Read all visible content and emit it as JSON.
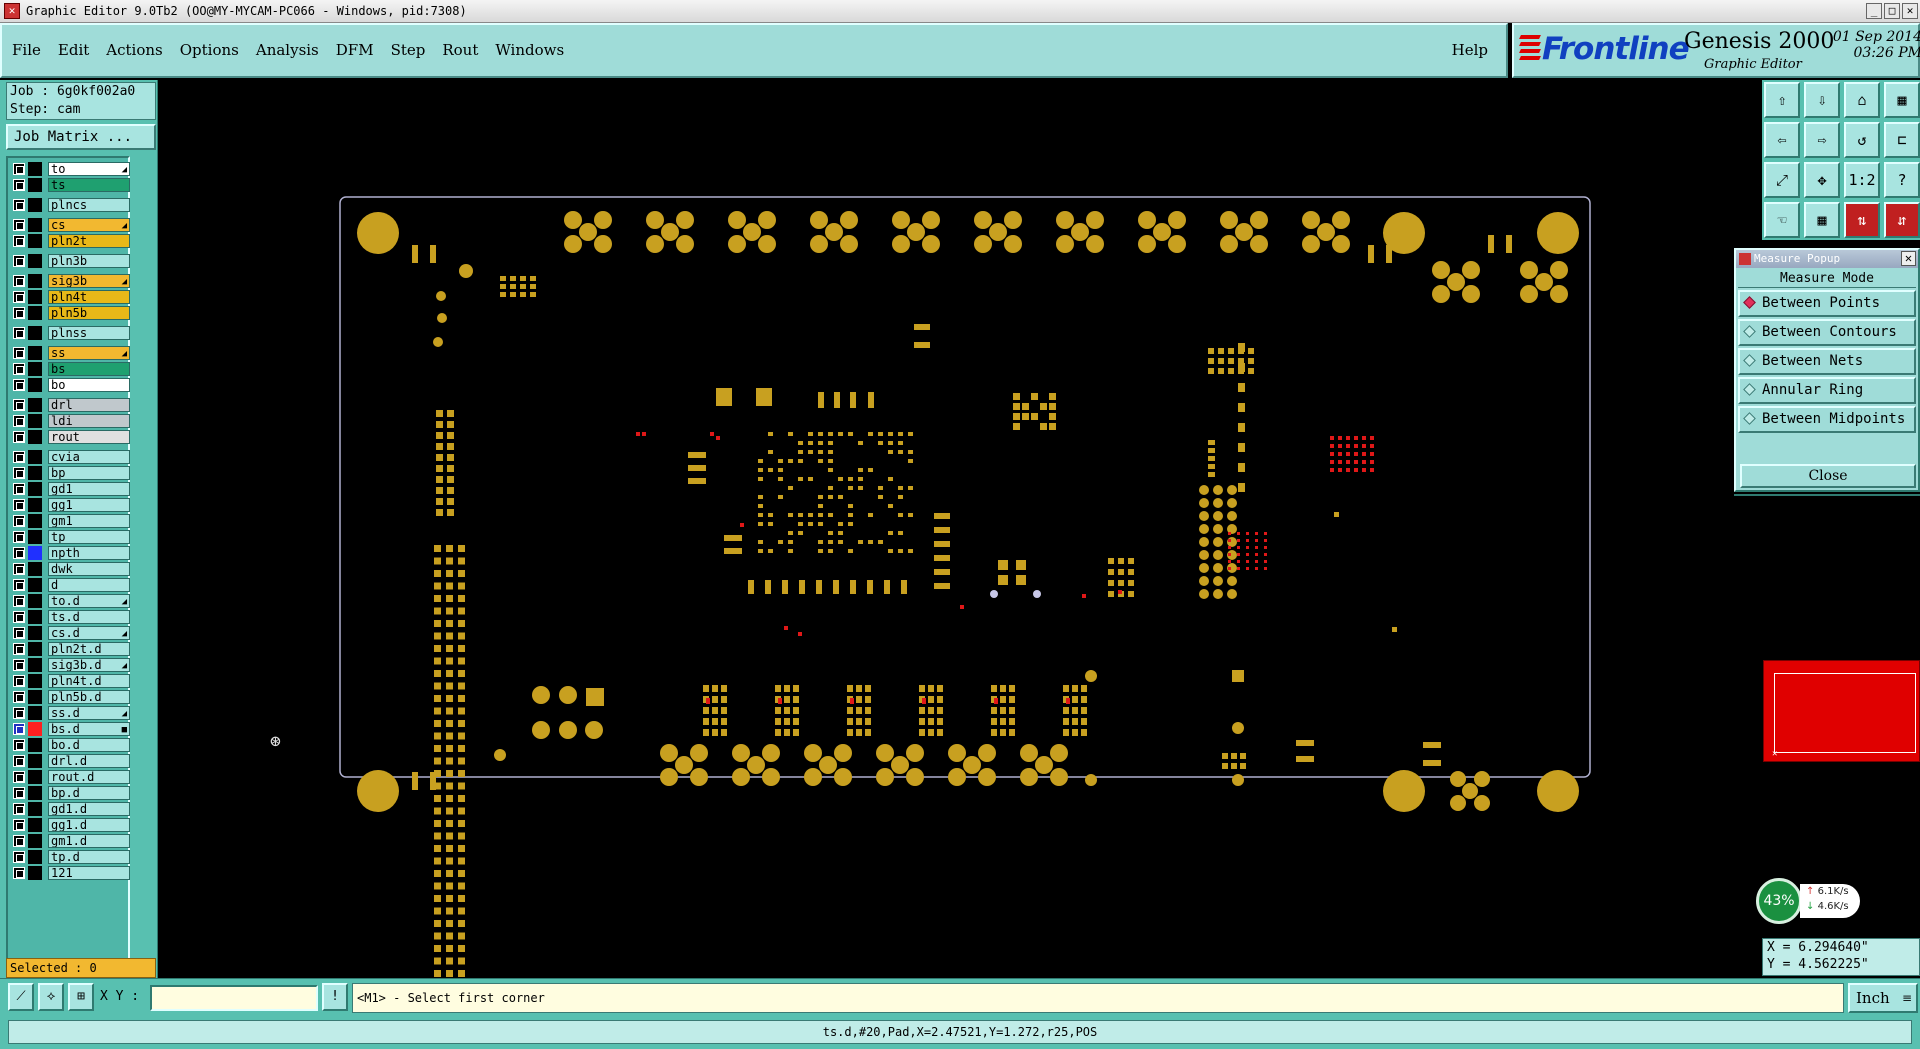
{
  "window": {
    "title": "Graphic Editor 9.0Tb2 (OO@MY-MYCAM-PC066 - Windows, pid:7308)",
    "controls": [
      "_",
      "□",
      "✕"
    ]
  },
  "menu": {
    "items": [
      "File",
      "Edit",
      "Actions",
      "Options",
      "Analysis",
      "DFM",
      "Step",
      "Rout",
      "Windows"
    ],
    "help": "Help"
  },
  "brand": {
    "logo": "Frontline",
    "product": "Genesis 2000",
    "subtitle": "Graphic Editor",
    "date": "01 Sep 2014",
    "time": "03:26 PM"
  },
  "job": {
    "job_line": "Job : 6g0kf002a0",
    "step_line": "Step: cam",
    "matrix_button": "Job Matrix ..."
  },
  "layers": [
    {
      "name": "to",
      "color": "#ffffff",
      "flag": "◢"
    },
    {
      "name": "ts",
      "color": "#1fa070",
      "flag": ""
    },
    {
      "name": "plncs",
      "color": "#a8e4e0",
      "flag": "",
      "gap": true
    },
    {
      "name": "cs",
      "color": "#f2b830",
      "flag": "◢",
      "gap": true
    },
    {
      "name": "pln2t",
      "color": "#e8b818",
      "flag": ""
    },
    {
      "name": "pln3b",
      "color": "#a8e4e0",
      "flag": "",
      "gap": true
    },
    {
      "name": "sig3b",
      "color": "#f2b830",
      "flag": "◢",
      "gap": true
    },
    {
      "name": "pln4t",
      "color": "#e8b818",
      "flag": ""
    },
    {
      "name": "pln5b",
      "color": "#e8b818",
      "flag": ""
    },
    {
      "name": "plnss",
      "color": "#a8e4e0",
      "flag": "",
      "gap": true
    },
    {
      "name": "ss",
      "color": "#f2b830",
      "flag": "◢",
      "gap": true
    },
    {
      "name": "bs",
      "color": "#1fa070",
      "flag": ""
    },
    {
      "name": "bo",
      "color": "#ffffff",
      "flag": ""
    },
    {
      "name": "drl",
      "color": "#c0c8cc",
      "flag": "",
      "gap": true
    },
    {
      "name": "ldi",
      "color": "#c0c8cc",
      "flag": ""
    },
    {
      "name": "rout",
      "color": "#e0e0e0",
      "flag": ""
    },
    {
      "name": "cvia",
      "color": "#a8e4e0",
      "flag": "",
      "gap": true
    },
    {
      "name": "bp",
      "color": "#a8e4e0",
      "flag": ""
    },
    {
      "name": "gd1",
      "color": "#a8e4e0",
      "flag": ""
    },
    {
      "name": "gg1",
      "color": "#a8e4e0",
      "flag": ""
    },
    {
      "name": "gm1",
      "color": "#a8e4e0",
      "flag": ""
    },
    {
      "name": "tp",
      "color": "#a8e4e0",
      "flag": ""
    },
    {
      "name": "npth",
      "color": "#a8e4e0",
      "flag": "",
      "swatch": "#2030ff"
    },
    {
      "name": "dwk",
      "color": "#a8e4e0",
      "flag": ""
    },
    {
      "name": "d",
      "color": "#a8e4e0",
      "flag": ""
    },
    {
      "name": "to.d",
      "color": "#a8e4e0",
      "flag": "◢"
    },
    {
      "name": "ts.d",
      "color": "#a8e4e0",
      "flag": ""
    },
    {
      "name": "cs.d",
      "color": "#a8e4e0",
      "flag": "◢"
    },
    {
      "name": "pln2t.d",
      "color": "#a8e4e0",
      "flag": ""
    },
    {
      "name": "sig3b.d",
      "color": "#a8e4e0",
      "flag": "◢"
    },
    {
      "name": "pln4t.d",
      "color": "#a8e4e0",
      "flag": ""
    },
    {
      "name": "pln5b.d",
      "color": "#a8e4e0",
      "flag": ""
    },
    {
      "name": "ss.d",
      "color": "#a8e4e0",
      "flag": "◢"
    },
    {
      "name": "bs.d",
      "color": "#a8e4e0",
      "flag": "■",
      "swatch": "#ff2020",
      "active": true
    },
    {
      "name": "bo.d",
      "color": "#a8e4e0",
      "flag": ""
    },
    {
      "name": "drl.d",
      "color": "#a8e4e0",
      "flag": ""
    },
    {
      "name": "rout.d",
      "color": "#a8e4e0",
      "flag": ""
    },
    {
      "name": "bp.d",
      "color": "#a8e4e0",
      "flag": ""
    },
    {
      "name": "gd1.d",
      "color": "#a8e4e0",
      "flag": ""
    },
    {
      "name": "gg1.d",
      "color": "#a8e4e0",
      "flag": ""
    },
    {
      "name": "gm1.d",
      "color": "#a8e4e0",
      "flag": ""
    },
    {
      "name": "tp.d",
      "color": "#a8e4e0",
      "flag": ""
    },
    {
      "name": "121",
      "color": "#a8e4e0",
      "flag": ""
    }
  ],
  "selected": "Selected : 0",
  "toolbar": {
    "buttons": [
      "⇧",
      "⇩",
      "⌂",
      "▦",
      "⇦",
      "⇨",
      "↺",
      "⊏",
      "⤢",
      "✥",
      "1:2",
      "?",
      "☜",
      "▦",
      "⇅",
      "⇵"
    ]
  },
  "measure": {
    "title": "Measure Popup",
    "mode_label": "Measure Mode",
    "options": [
      "Between Points",
      "Between Contours",
      "Between Nets",
      "Annular Ring",
      "Between Midpoints"
    ],
    "selected_option": "Between Points",
    "close_label": "Close"
  },
  "netmon": {
    "percent": "43%",
    "up": "6.1K/s",
    "down": "4.6K/s"
  },
  "coords": {
    "x": "X = 6.294640\"",
    "y": "Y = 4.562225\""
  },
  "bottom": {
    "xy_label": "X Y :",
    "xy_value": "",
    "prompt": "<M1> - Select first corner",
    "units": "Inch",
    "status": "ts.d,#20,Pad,X=2.47521,Y=1.272,r25,POS"
  },
  "colors": {
    "copper": "#c8a020",
    "marker": "#e01818",
    "board_outline": "#b0b0d0",
    "panel_bg": "#58c0b0",
    "panel_face": "#a8e4e0"
  }
}
